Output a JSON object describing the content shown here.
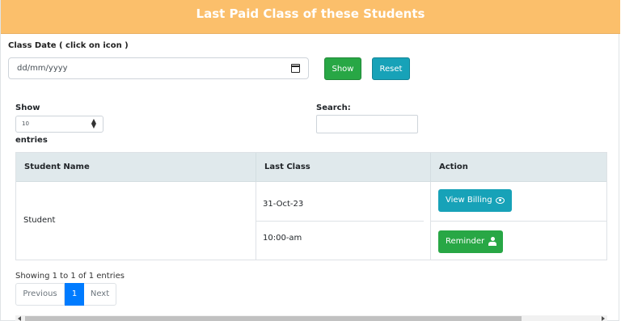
{
  "header": {
    "title": "Last Paid Class of these Students"
  },
  "filter": {
    "date_label": "Class Date ( click on icon )",
    "date_placeholder": "dd/mm/yyyy",
    "show_button": "Show",
    "reset_button": "Reset"
  },
  "length": {
    "show_label": "Show",
    "selected": "10",
    "entries_label": "entries"
  },
  "search": {
    "label": "Search:",
    "value": ""
  },
  "table": {
    "columns": [
      "Student Name",
      "Last Class",
      "Action"
    ],
    "rows": [
      {
        "student_name": "Student",
        "last_class_date": "31-Oct-23",
        "last_class_time": "10:00-am",
        "billing_button": "View Billing",
        "reminder_button": "Reminder"
      }
    ]
  },
  "footer": {
    "info": "Showing 1 to 1 of 1 entries",
    "pagination": {
      "previous": "Previous",
      "current": "1",
      "next": "Next"
    }
  },
  "icons": {
    "calendar": "calendar-icon",
    "select_arrows": "sort-arrows-icon",
    "billing": "eye-icon",
    "reminder": "user-icon"
  },
  "colors": {
    "header_bg": "#fbbf6b",
    "success": "#28a745",
    "info": "#17a2b8",
    "primary": "#007bff",
    "table_head_bg": "#e0e9ec"
  }
}
